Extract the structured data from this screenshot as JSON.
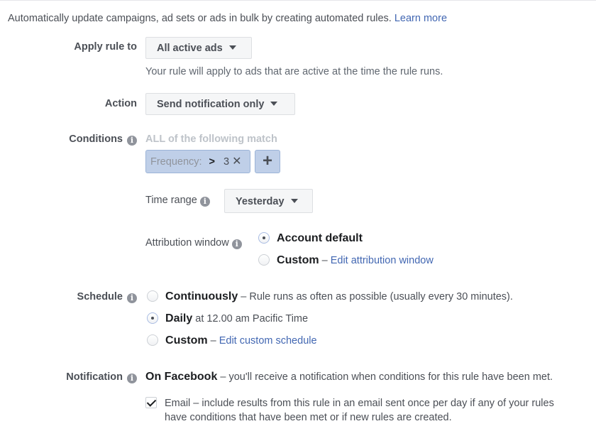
{
  "intro": {
    "text": "Automatically update campaigns, ad sets or ads in bulk by creating automated rules.",
    "learn_more": "Learn more"
  },
  "apply_rule": {
    "label": "Apply rule to",
    "value": "All active ads",
    "hint": "Your rule will apply to ads that are active at the time the rule runs."
  },
  "action": {
    "label": "Action",
    "value": "Send notification only"
  },
  "conditions": {
    "label": "Conditions",
    "match_text": "ALL of the following match",
    "token": {
      "field": "Frequency:",
      "operator": ">",
      "value": "3"
    },
    "add_label": "+"
  },
  "time_range": {
    "label": "Time range",
    "value": "Yesterday"
  },
  "attribution": {
    "label": "Attribution window",
    "options": [
      {
        "label": "Account default",
        "checked": true
      },
      {
        "label": "Custom",
        "suffix": " – ",
        "link": "Edit attribution window",
        "checked": false
      }
    ]
  },
  "schedule": {
    "label": "Schedule",
    "options": [
      {
        "label": "Continuously",
        "desc": " – Rule runs as often as possible (usually every 30 minutes).",
        "checked": false
      },
      {
        "label": "Daily",
        "desc": " at 12.00 am Pacific Time",
        "checked": true
      },
      {
        "label": "Custom",
        "desc": " – ",
        "link": "Edit custom schedule",
        "checked": false
      }
    ]
  },
  "notification": {
    "label": "Notification",
    "facebook_label": "On Facebook",
    "facebook_desc": " – you'll receive a notification when conditions for this rule have been met.",
    "email_checked": true,
    "email_line1": "Email – include results from this rule in an email sent once per day if any of your rules",
    "email_line2": "have conditions that have been met or if new rules are created."
  }
}
